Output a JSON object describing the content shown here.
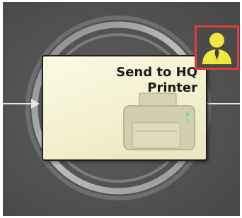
{
  "node": {
    "label": "Send to HQ\nPrinter",
    "icon": "printer-icon"
  },
  "assignee": {
    "icon": "user-icon",
    "highlighted": true
  },
  "colors": {
    "canvas": "#545454",
    "card": "#f3f0cf",
    "highlight": "#e23a3a",
    "user_icon": "#f0e83a"
  }
}
